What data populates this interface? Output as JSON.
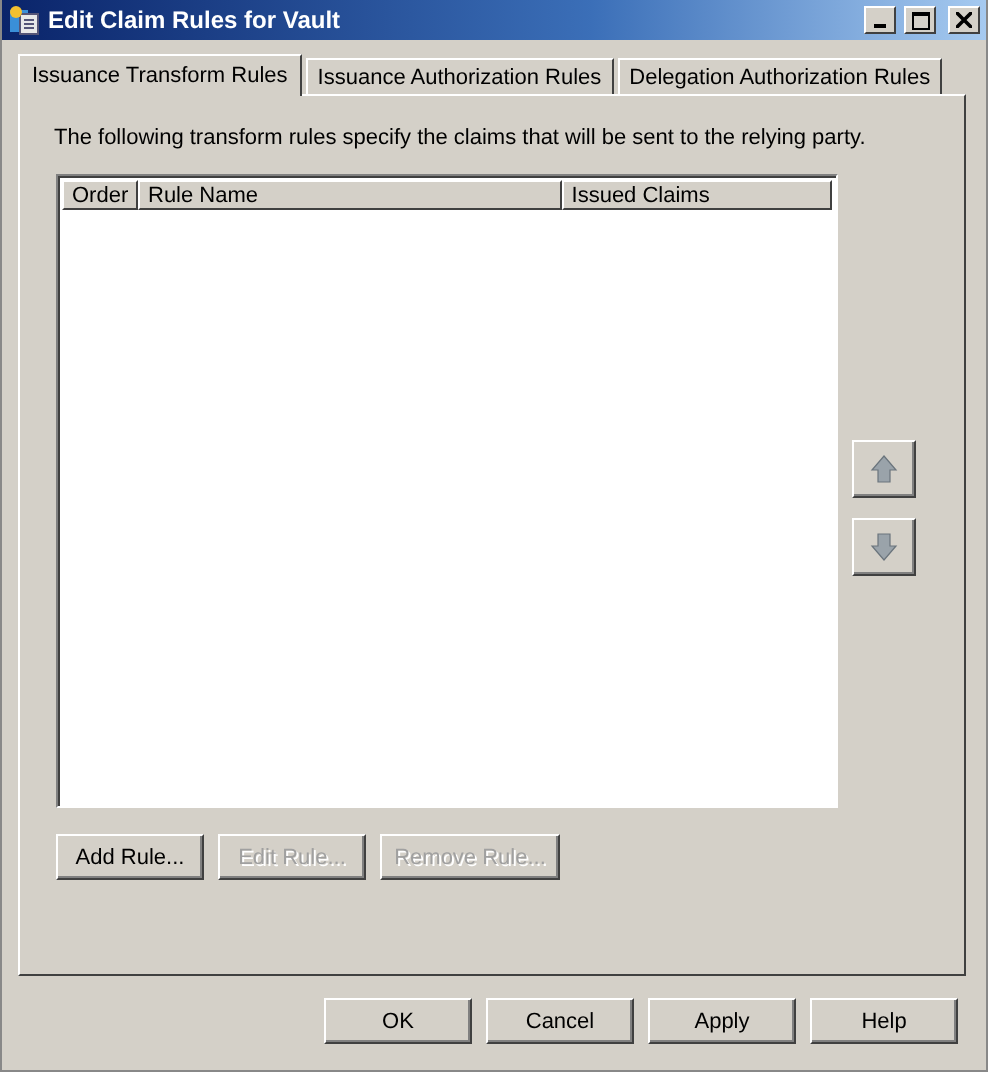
{
  "window": {
    "title": "Edit Claim Rules for Vault"
  },
  "tabs": [
    {
      "label": "Issuance Transform Rules",
      "selected": true
    },
    {
      "label": "Issuance Authorization Rules",
      "selected": false
    },
    {
      "label": "Delegation Authorization Rules",
      "selected": false
    }
  ],
  "description": "The following transform rules specify the claims that will be sent to the relying party.",
  "table": {
    "columns": [
      "Order",
      "Rule Name",
      "Issued Claims"
    ]
  },
  "move_buttons": [
    {
      "kind": "up",
      "disabled": true
    },
    {
      "kind": "down",
      "disabled": true
    }
  ],
  "rule_buttons": [
    {
      "label": "Add Rule...",
      "disabled": false
    },
    {
      "label": "Edit Rule...",
      "disabled": true
    },
    {
      "label": "Remove Rule...",
      "disabled": true
    }
  ],
  "dialog_buttons": [
    {
      "label": "OK",
      "disabled": false
    },
    {
      "label": "Cancel",
      "disabled": false
    },
    {
      "label": "Apply",
      "disabled": false
    },
    {
      "label": "Help",
      "disabled": false
    }
  ]
}
